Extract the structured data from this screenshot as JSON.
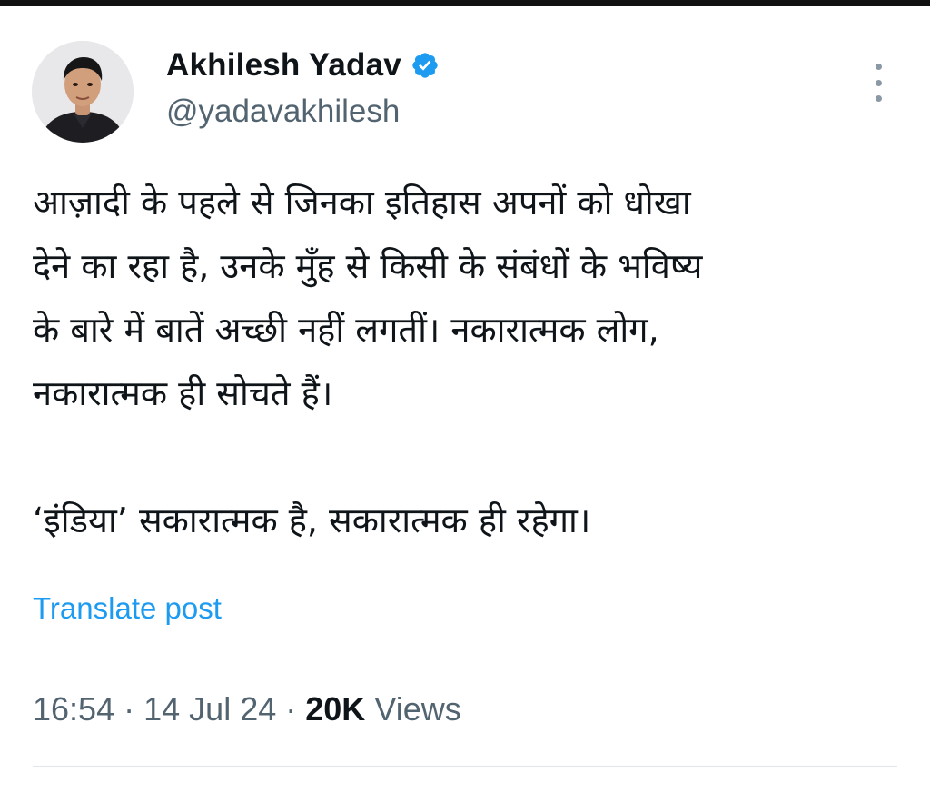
{
  "author": {
    "display_name": "Akhilesh Yadav",
    "handle": "@yadavakhilesh",
    "verified": true,
    "verified_color": "#1d9bf0"
  },
  "icons": {
    "avatar": "profile-photo",
    "verified": "verified-badge-icon",
    "more": "more-vertical-icon"
  },
  "tweet": {
    "lines": [
      "आज़ादी के पहले से जिनका इतिहास अपनों को धोखा",
      "देने का रहा है, उनके मुँह से किसी के संबंधों के भविष्य",
      "के बारे में बातें अच्छी नहीं लगतीं। नकारात्मक लोग,",
      "नकारात्मक ही सोचते हैं।",
      "‘इंडिया’ सकारात्मक है, सकारात्मक ही रहेगा।"
    ]
  },
  "translate_label": "Translate post",
  "meta": {
    "time": "16:54",
    "separator": "·",
    "date": "14 Jul 24",
    "views_count": "20K",
    "views_label": "Views"
  },
  "colors": {
    "link": "#1d9bf0",
    "secondary_text": "#536471",
    "primary_text": "#0f1419"
  }
}
